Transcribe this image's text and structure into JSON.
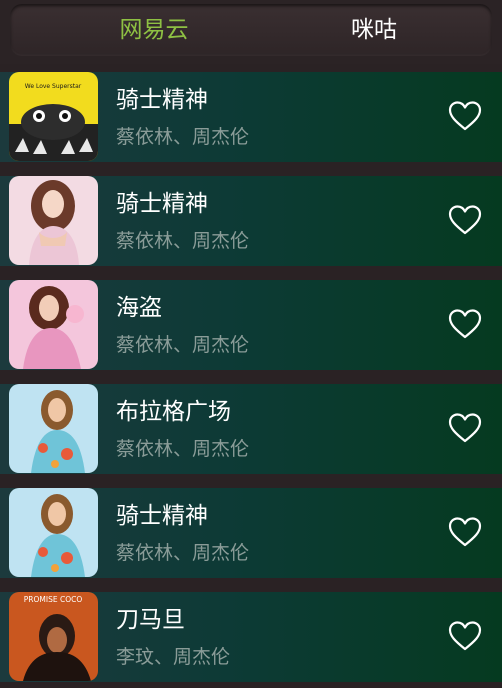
{
  "tabs": [
    {
      "label": "网易云",
      "color": "#8ec043",
      "active": true
    },
    {
      "label": "咪咕",
      "color": "#ffffff",
      "active": false
    }
  ],
  "songs": [
    {
      "title": "骑士精神",
      "artist": "蔡依林、周杰伦",
      "cover": "cover-yellow-album",
      "cover_text": "We Love Superstar"
    },
    {
      "title": "骑士精神",
      "artist": "蔡依林、周杰伦",
      "cover": "cover-pink-portrait"
    },
    {
      "title": "海盗",
      "artist": "蔡依林、周杰伦",
      "cover": "cover-pink-portrait-2"
    },
    {
      "title": "布拉格广场",
      "artist": "蔡依林、周杰伦",
      "cover": "cover-blue-floral"
    },
    {
      "title": "骑士精神",
      "artist": "蔡依林、周杰伦",
      "cover": "cover-blue-floral"
    },
    {
      "title": "刀马旦",
      "artist": "李玟、周杰伦",
      "cover": "cover-orange-promise",
      "cover_text": "PROMISE COCO"
    }
  ],
  "icons": {
    "favorite": "heart-outline-icon"
  }
}
